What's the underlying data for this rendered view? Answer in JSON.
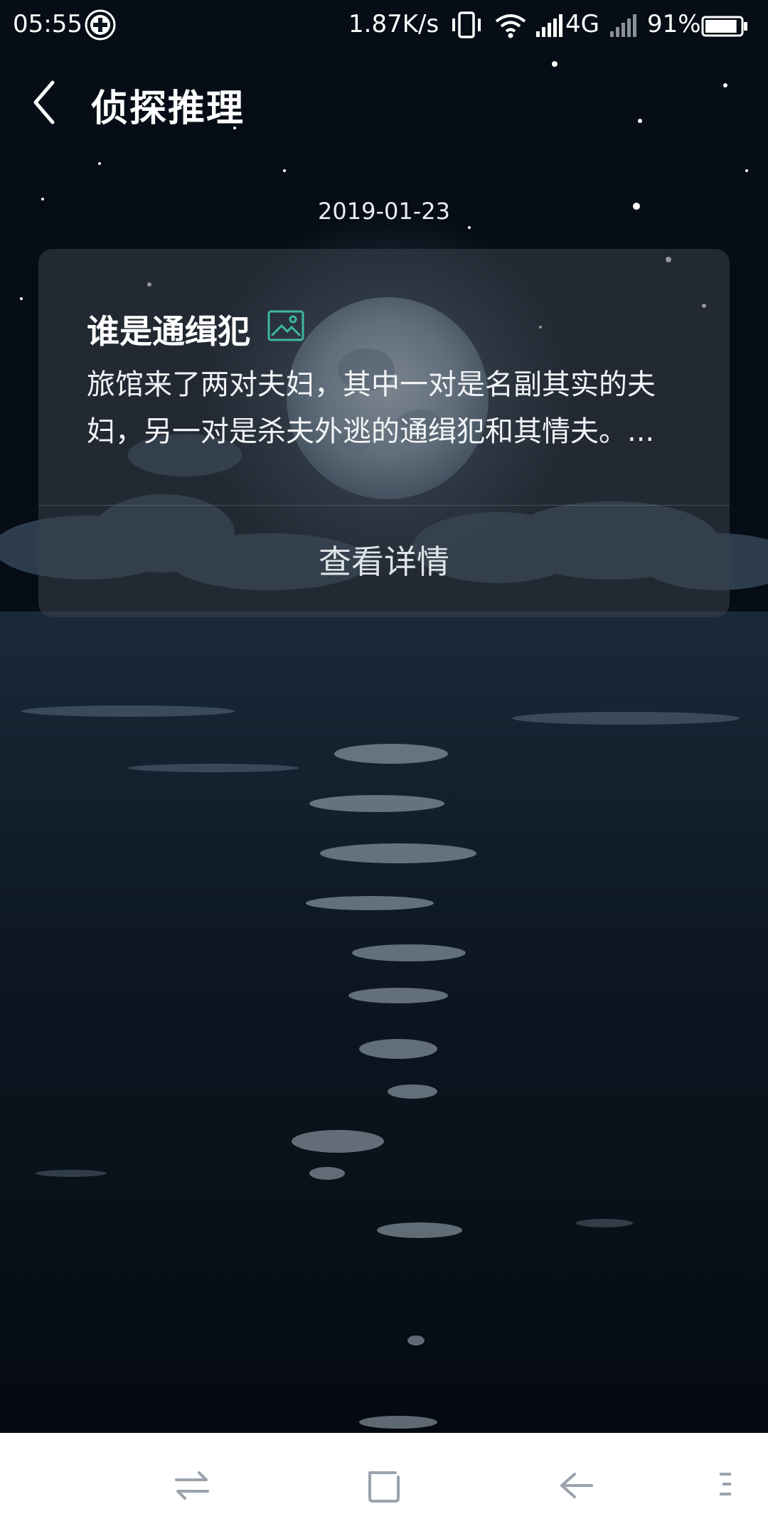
{
  "status_bar": {
    "time": "05:55",
    "network_speed": "1.87K/s",
    "network_type": "4G",
    "battery_percent": "91%",
    "battery_level": 0.91,
    "icons": [
      "plus-circle-icon",
      "vibrate-icon",
      "wifi-icon",
      "signal-icon",
      "signal-icon",
      "battery-icon"
    ]
  },
  "header": {
    "title": "侦探推理",
    "back_icon": "chevron-left-icon"
  },
  "feed": {
    "date": "2019-01-23",
    "card": {
      "title": "谁是通缉犯",
      "title_icon": "image-icon",
      "description": "旅馆来了两对夫妇，其中一对是名副其实的夫\n妇，另一对是杀夫外逃的通缉犯和其情夫。...",
      "detail_label": "查看详情"
    }
  },
  "nav_bar": {
    "icons": [
      "switch-icon",
      "home-square-icon",
      "back-arrow-icon",
      "menu-icon"
    ]
  },
  "colors": {
    "accent_icon": "#3fb8a0",
    "nav_icon": "#9aa3ad",
    "nav_background": "#ffffff"
  }
}
